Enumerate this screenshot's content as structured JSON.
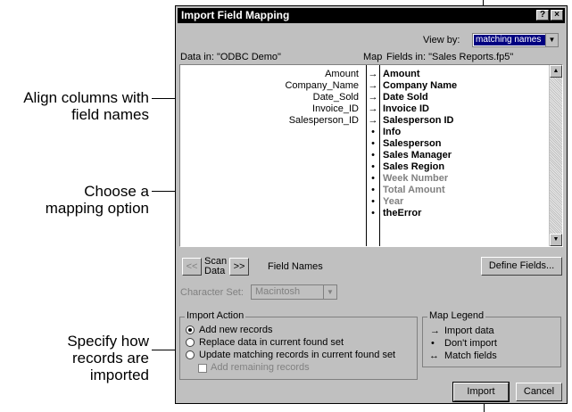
{
  "callouts": {
    "align": [
      "Align columns with",
      "field names"
    ],
    "mapping": [
      "Choose a",
      "mapping option"
    ],
    "specify": [
      "Specify how",
      "records are",
      "imported"
    ]
  },
  "dialog": {
    "title": "Import Field Mapping",
    "help_btn": "?",
    "close_btn": "×",
    "view_by_label": "View by:",
    "view_by_value": "matching names",
    "data_in_label": "Data in: \"ODBC Demo\"",
    "map_label": "Map",
    "fields_in_label": "Fields in: \"Sales Reports.fp5\"",
    "source_fields": [
      "Amount",
      "Company_Name",
      "Date_Sold",
      "Invoice_ID",
      "Salesperson_ID"
    ],
    "map_symbols": [
      "→",
      "→",
      "→",
      "→",
      "→",
      "•",
      "•",
      "•",
      "•",
      "•",
      "•",
      "•",
      "•"
    ],
    "target_fields": [
      {
        "name": "Amount",
        "dim": false
      },
      {
        "name": "Company Name",
        "dim": false
      },
      {
        "name": "Date Sold",
        "dim": false
      },
      {
        "name": "Invoice ID",
        "dim": false
      },
      {
        "name": "Salesperson ID",
        "dim": false
      },
      {
        "name": "Info",
        "dim": false
      },
      {
        "name": "Salesperson",
        "dim": false
      },
      {
        "name": "Sales Manager",
        "dim": false
      },
      {
        "name": "Sales Region",
        "dim": false
      },
      {
        "name": "Week Number",
        "dim": true
      },
      {
        "name": "Total Amount",
        "dim": true
      },
      {
        "name": "Year",
        "dim": true
      },
      {
        "name": "theError",
        "dim": false
      }
    ],
    "scan_prev": "<<",
    "scan_label": "Scan Data",
    "scan_next": ">>",
    "field_names_label": "Field Names",
    "define_fields_btn": "Define Fields...",
    "charset_label": "Character Set:",
    "charset_value": "Macintosh",
    "import_action": {
      "title": "Import Action",
      "options": [
        "Add new records",
        "Replace data in current found set",
        "Update matching records in current found set"
      ],
      "selected": 0,
      "add_remaining": "Add remaining records"
    },
    "legend": {
      "title": "Map Legend",
      "items": [
        {
          "symbol": "→",
          "text": "Import data"
        },
        {
          "symbol": "•",
          "text": "Don't import"
        },
        {
          "symbol": "↔",
          "text": "Match fields"
        }
      ]
    },
    "import_btn": "Import",
    "cancel_btn": "Cancel"
  }
}
